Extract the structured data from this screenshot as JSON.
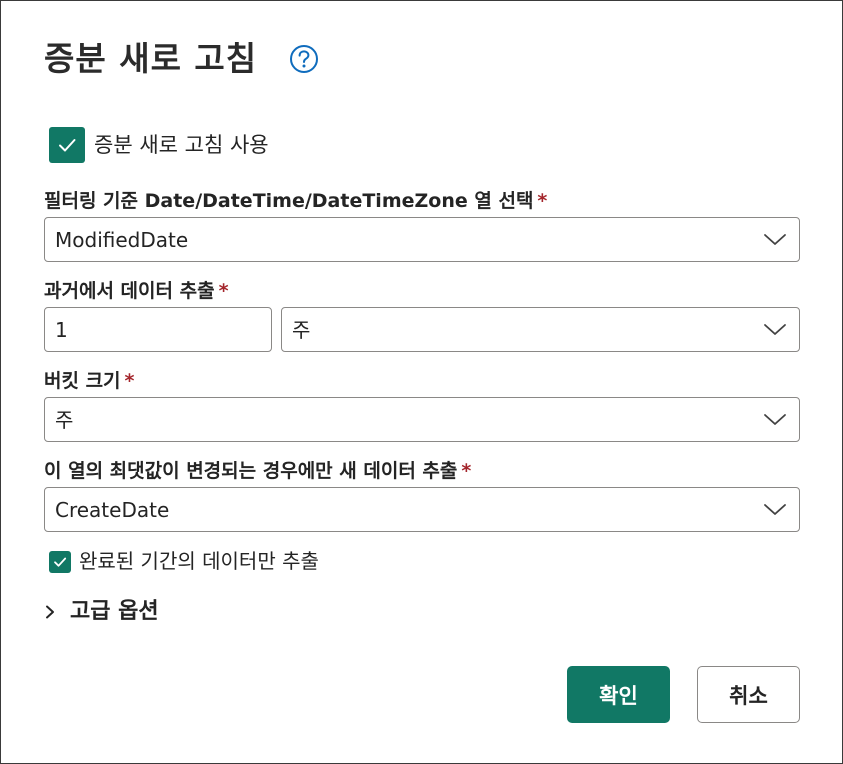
{
  "dialog": {
    "title": "증분 새로 고침",
    "help_icon": "question-circle-icon",
    "enable_checkbox": {
      "label": "증분 새로 고침 사용",
      "checked": true
    },
    "filter_field": {
      "label": "필터링 기준 Date/DateTime/DateTimeZone 열 선택",
      "required_mark": "*",
      "value": "ModifiedDate"
    },
    "extract_past": {
      "label": "과거에서 데이터 추출",
      "required_mark": "*",
      "amount": "1",
      "unit": "주"
    },
    "bucket_size": {
      "label": "버킷 크기",
      "required_mark": "*",
      "value": "주"
    },
    "max_change": {
      "label": "이 열의 최댓값이 변경되는 경우에만 새 데이터 추출",
      "required_mark": "*",
      "value": "CreateDate"
    },
    "complete_periods_checkbox": {
      "label": "완료된 기간의 데이터만 추출",
      "checked": true
    },
    "advanced": {
      "label": "고급 옵션",
      "icon": "chevron-right-icon"
    },
    "buttons": {
      "ok": "확인",
      "cancel": "취소"
    }
  },
  "colors": {
    "accent": "#117865",
    "required": "#a4262c",
    "help_icon": "#0f6cbd",
    "border": "#8a8886"
  }
}
